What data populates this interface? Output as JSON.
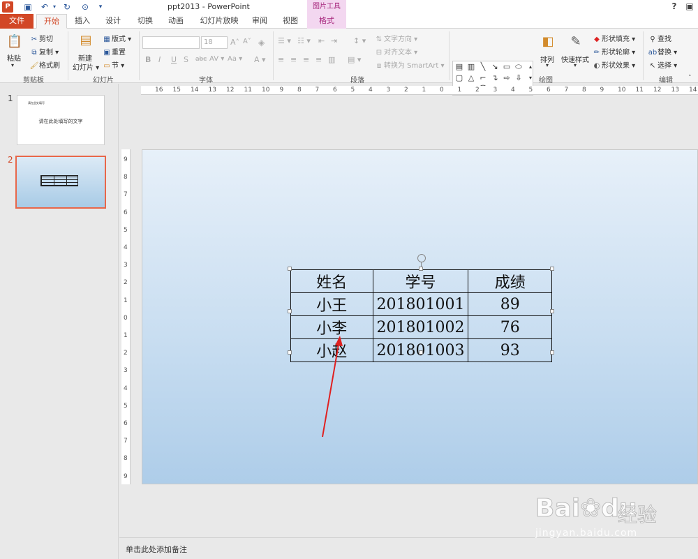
{
  "app": {
    "title": "ppt2013 - PowerPoint",
    "icon": "P"
  },
  "context_tab_group": "图片工具",
  "tabs": [
    "文件",
    "开始",
    "插入",
    "设计",
    "切换",
    "动画",
    "幻灯片放映",
    "审阅",
    "视图",
    "格式"
  ],
  "active_tab": "开始",
  "window_controls": {
    "help": "?"
  },
  "clipboard": {
    "paste": "粘贴",
    "cut": "剪切",
    "copy": "复制",
    "format_painter": "格式刷",
    "label": "剪贴板"
  },
  "slides_group": {
    "new_slide": "新建",
    "new_slide_2": "幻灯片",
    "layout": "版式",
    "reset": "重置",
    "section": "节",
    "label": "幻灯片"
  },
  "font_group": {
    "font_size": "18",
    "label": "字体"
  },
  "paragraph_group": {
    "text_direction": "文字方向",
    "align_text": "对齐文本",
    "convert_smartart": "转换为 SmartArt",
    "label": "段落"
  },
  "drawing_group": {
    "arrange": "排列",
    "quick_styles": "快速样式",
    "shape_fill": "形状填充",
    "shape_outline": "形状轮廓",
    "shape_effects": "形状效果",
    "label": "绘图"
  },
  "editing_group": {
    "find": "查找",
    "replace": "替换",
    "select": "选择",
    "label": "编辑"
  },
  "thumbnails": [
    {
      "num": "1",
      "text_small": "请在此处填写",
      "text": "请在此处填写的文字"
    },
    {
      "num": "2"
    }
  ],
  "hruler_labels": [
    "16",
    "15",
    "14",
    "13",
    "12",
    "11",
    "10",
    "9",
    "8",
    "7",
    "6",
    "5",
    "4",
    "3",
    "2",
    "1",
    "0",
    "1",
    "2",
    "3",
    "4",
    "5",
    "6",
    "7",
    "8",
    "9",
    "10",
    "11",
    "12",
    "13",
    "14"
  ],
  "vruler_labels": [
    "9",
    "8",
    "7",
    "6",
    "5",
    "4",
    "3",
    "2",
    "1",
    "0",
    "1",
    "2",
    "3",
    "4",
    "5",
    "6",
    "7",
    "8",
    "9"
  ],
  "table": {
    "headers": [
      "姓名",
      "学号",
      "成绩"
    ],
    "rows": [
      [
        "小王",
        "201801001",
        "89"
      ],
      [
        "小李",
        "201801002",
        "76"
      ],
      [
        "小赵",
        "201801003",
        "93"
      ]
    ]
  },
  "notes_placeholder": "单击此处添加备注",
  "watermark": {
    "brand": "Bai",
    "brand2": "du",
    "cn": "经验",
    "url": "jingyan.baidu.com"
  },
  "colors": {
    "accent": "#d24726",
    "context": "#a6257c",
    "arrow": "#e02020"
  }
}
